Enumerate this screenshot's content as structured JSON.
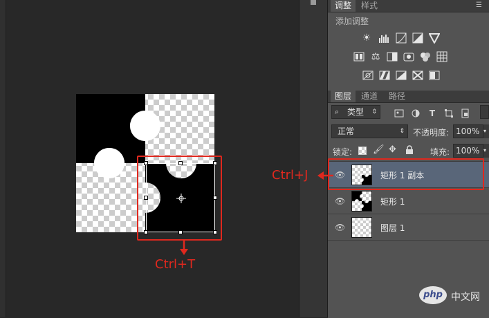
{
  "adjust_panel": {
    "tabs": [
      {
        "label": "调整",
        "active": true
      },
      {
        "label": "样式",
        "active": false
      }
    ],
    "header": "添加调整",
    "icons_row1": [
      "brightness-icon",
      "levels-icon",
      "curves-icon",
      "exposure-icon",
      "vibrance-icon"
    ],
    "icons_row2": [
      "hue-saturation-icon",
      "color-balance-icon",
      "black-white-icon",
      "photo-filter-icon",
      "channel-mixer-icon",
      "color-lookup-icon"
    ],
    "icons_row3": [
      "invert-icon",
      "posterize-icon",
      "threshold-icon",
      "selective-color-icon",
      "gradient-map-icon"
    ]
  },
  "layers_panel": {
    "tabs": [
      {
        "label": "图层",
        "active": true
      },
      {
        "label": "通道",
        "active": false
      },
      {
        "label": "路径",
        "active": false
      }
    ],
    "filter_kind": "类型",
    "blend_mode": "正常",
    "opacity_label": "不透明度:",
    "opacity_value": "100%",
    "lock_label": "锁定:",
    "fill_label": "填充:",
    "fill_value": "100%",
    "layers": [
      {
        "name": "矩形 1 副本",
        "selected": true,
        "thumb": "shape-copy"
      },
      {
        "name": "矩形 1",
        "selected": false,
        "thumb": "shape"
      },
      {
        "name": "图层 1",
        "selected": false,
        "thumb": "empty"
      }
    ]
  },
  "annotations": {
    "ctrl_t": "Ctrl+T",
    "ctrl_j": "Ctrl+J"
  },
  "colors": {
    "annotation_red": "#e0281e",
    "selected_layer": "#596679",
    "panel_bg": "#535353",
    "canvas_bg": "#282828"
  }
}
